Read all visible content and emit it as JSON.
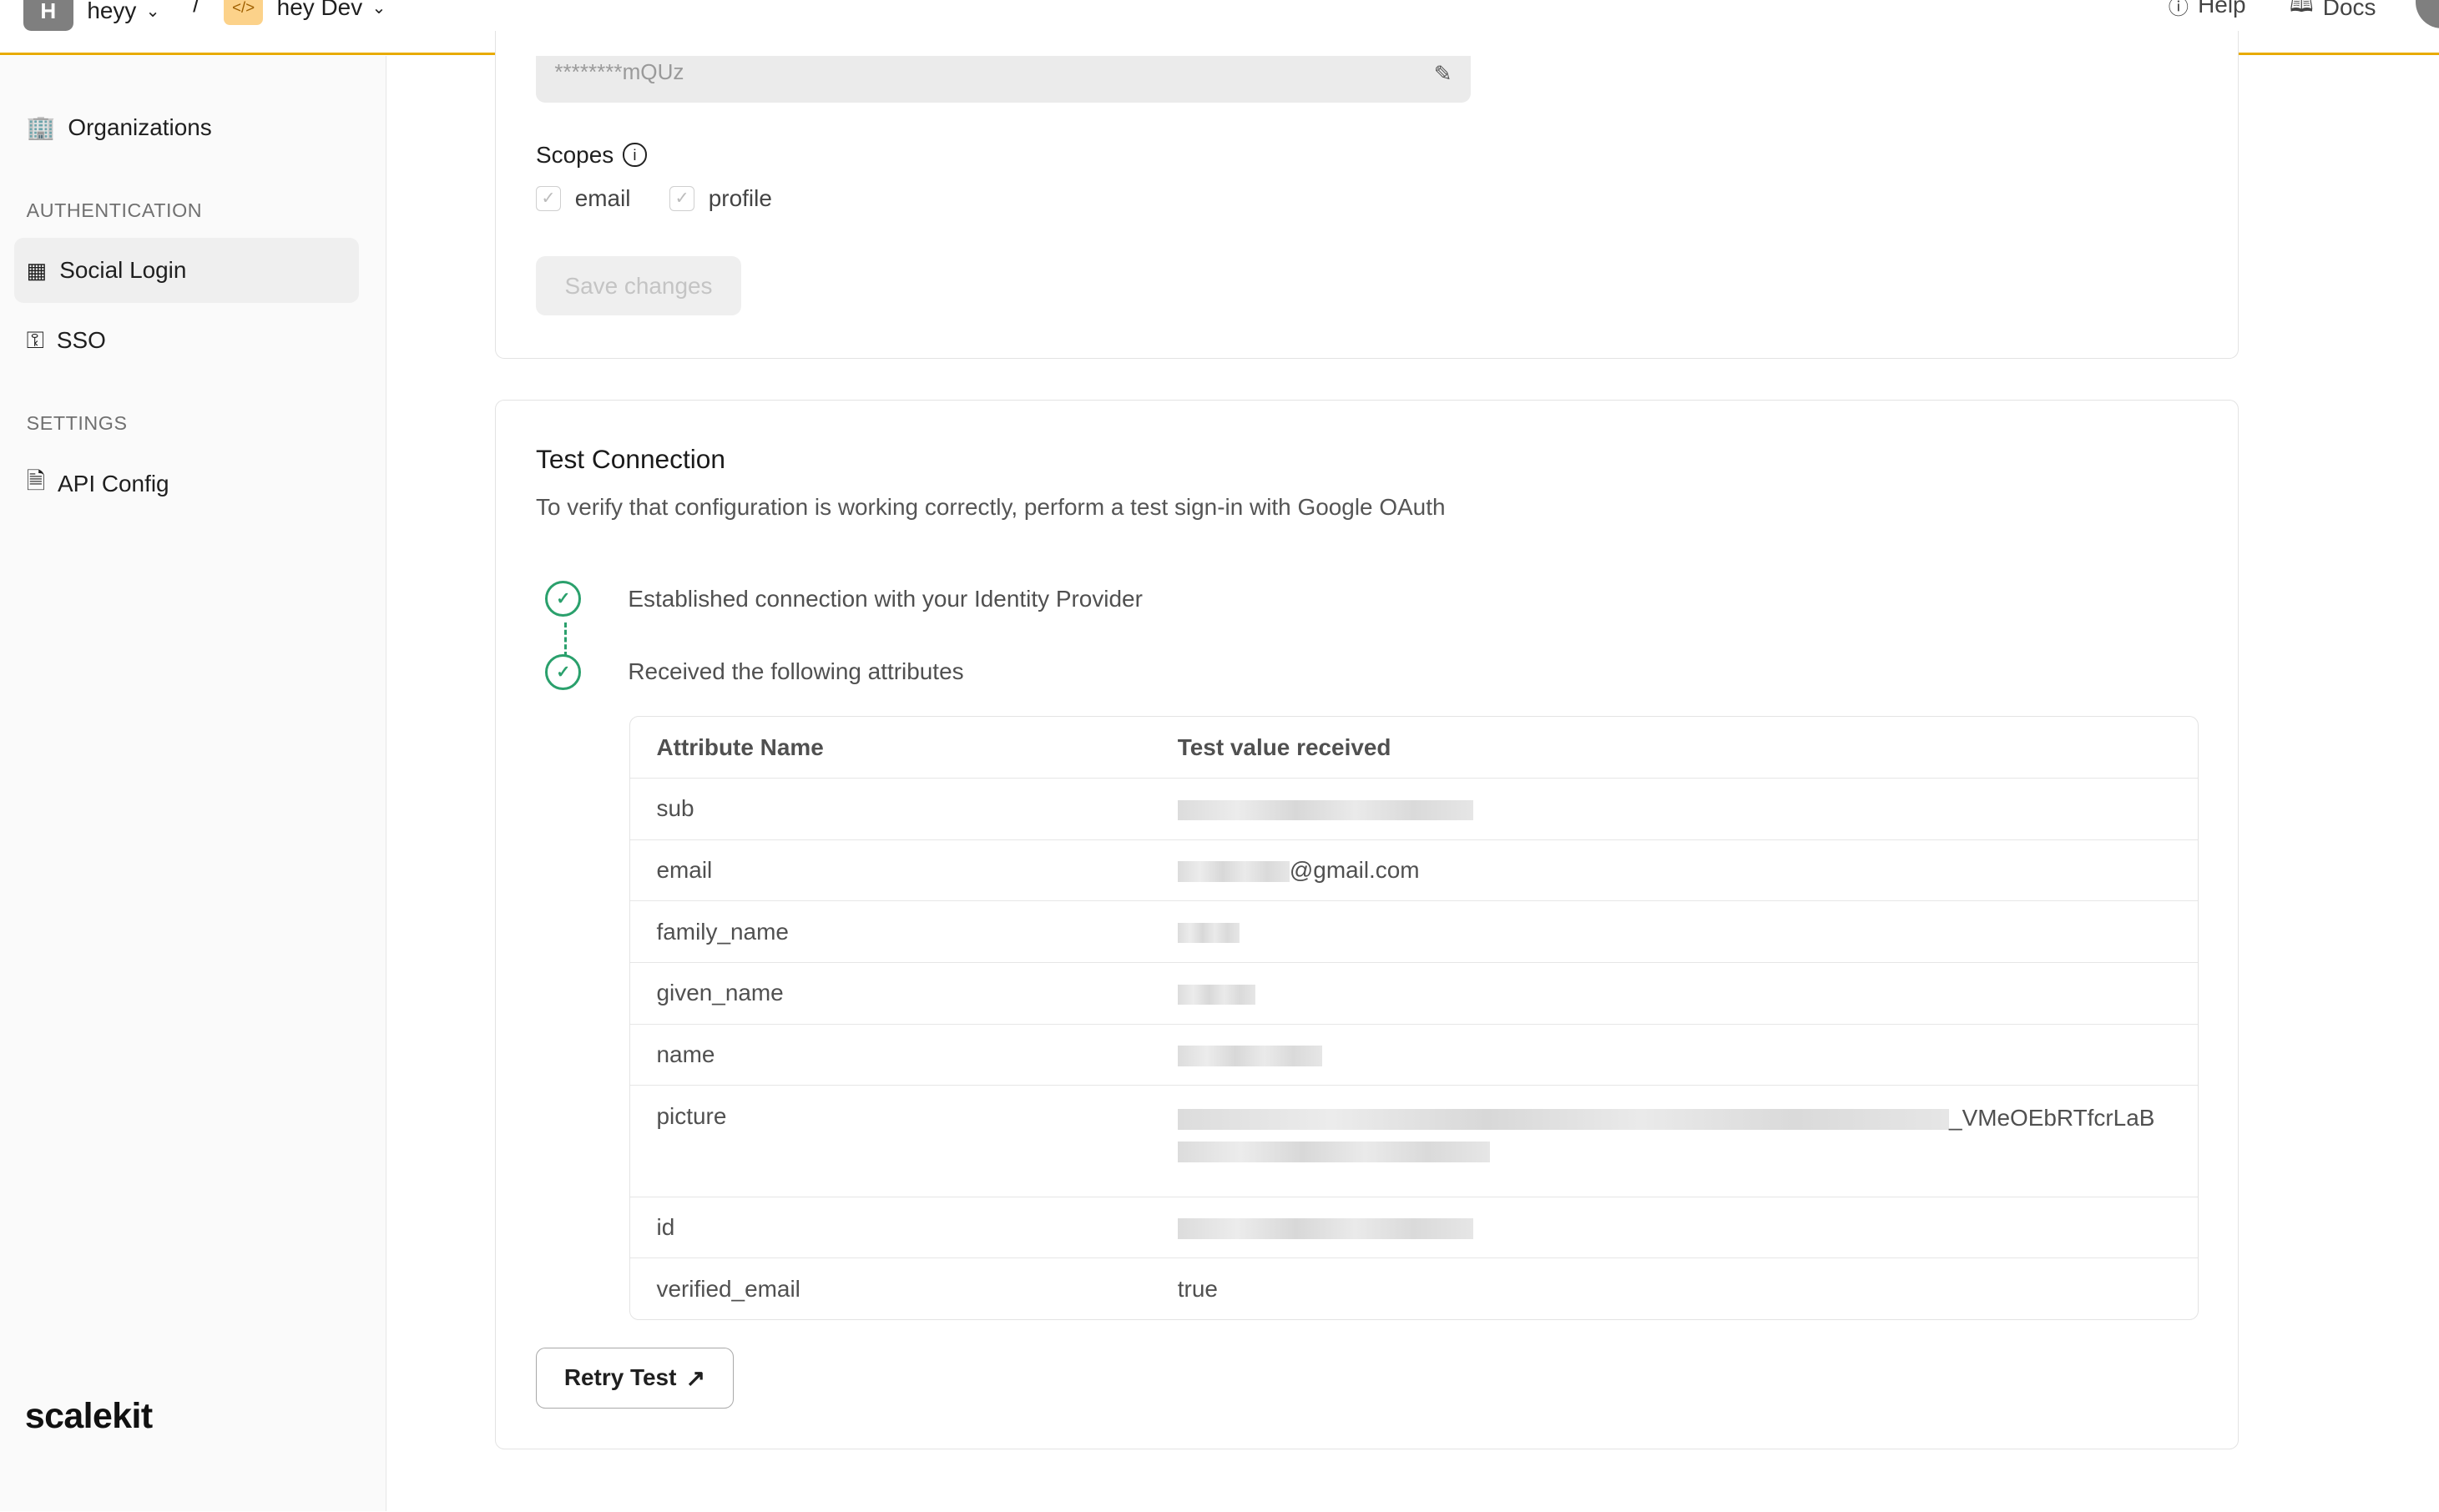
{
  "topbar": {
    "workspace_initial": "H",
    "workspace_name": "heyy",
    "separator": "/",
    "environment_name": "hey Dev",
    "help_label": "Help",
    "docs_label": "Docs",
    "accent_color": "#e8ab00"
  },
  "sidebar": {
    "items_top": [
      {
        "label": "Organizations",
        "icon": "building-icon"
      }
    ],
    "sections": [
      {
        "title": "AUTHENTICATION",
        "items": [
          {
            "label": "Social Login",
            "icon": "grid-icon",
            "active": true
          },
          {
            "label": "SSO",
            "icon": "key-icon"
          }
        ]
      },
      {
        "title": "SETTINGS",
        "items": [
          {
            "label": "API Config",
            "icon": "file-code-icon"
          }
        ]
      }
    ],
    "logo": "scalekit"
  },
  "config": {
    "client_secret_value": "********mQUz",
    "scopes_label": "Scopes",
    "scopes": [
      {
        "label": "email",
        "checked": true
      },
      {
        "label": "profile",
        "checked": true
      }
    ],
    "save_label": "Save changes"
  },
  "test": {
    "title": "Test Connection",
    "description": "To verify that configuration is working correctly, perform a test sign-in with Google OAuth",
    "steps": [
      "Established connection with your Identity Provider",
      "Received the following attributes"
    ],
    "status_color": "#2aa06c",
    "table": {
      "headers": [
        "Attribute Name",
        "Test value received"
      ],
      "rows": [
        {
          "name": "sub",
          "value": ""
        },
        {
          "name": "email",
          "value": "@gmail.com"
        },
        {
          "name": "family_name",
          "value": ""
        },
        {
          "name": "given_name",
          "value": ""
        },
        {
          "name": "name",
          "value": ""
        },
        {
          "name": "picture",
          "value": "_VMeOEbRTfcrLaB"
        },
        {
          "name": "id",
          "value": ""
        },
        {
          "name": "verified_email",
          "value": "true"
        }
      ]
    },
    "retry_label": "Retry Test"
  }
}
